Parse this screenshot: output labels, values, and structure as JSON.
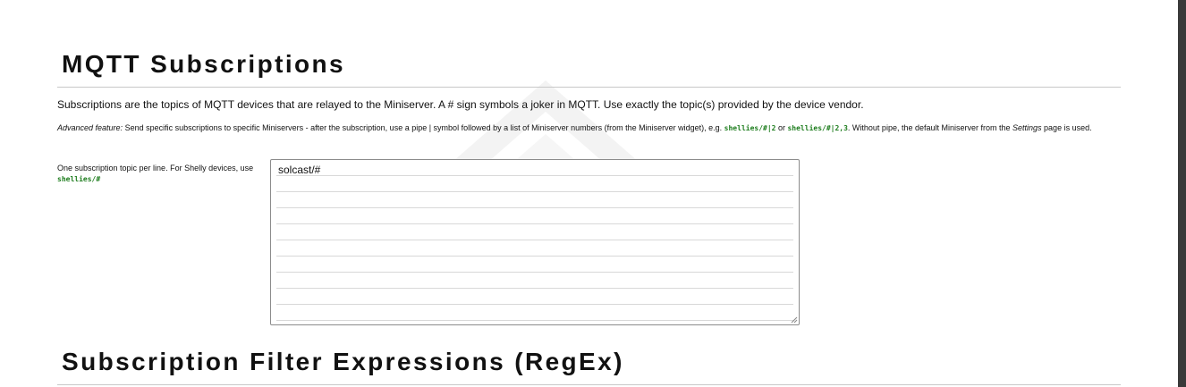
{
  "mqtt_section": {
    "title": "MQTT Subscriptions",
    "intro": "Subscriptions are the topics of MQTT devices that are relayed to the Miniserver. A # sign symbols a joker in MQTT. Use exactly the topic(s) provided by the device vendor.",
    "advanced": {
      "label": "Advanced feature:",
      "text_1": " Send specific subscriptions to specific Miniservers - after the subscription, use a pipe | symbol followed by a list of Miniserver numbers (from the Miniserver widget), e.g. ",
      "example_1": "shellies/#|2",
      "or": " or ",
      "example_2": "shellies/#|2,3",
      "text_2": ". Without pipe, the default Miniserver from the ",
      "settings": "Settings",
      "text_3": " page is used."
    },
    "help": {
      "text": "One subscription topic per line. For Shelly devices, use ",
      "code": "shellies/#"
    },
    "subscriptions": {
      "lines": [
        "solcast/#",
        "",
        "",
        "",
        "",
        "",
        "",
        "",
        "",
        ""
      ]
    }
  },
  "filter_section": {
    "title": "Subscription Filter Expressions (RegEx)"
  },
  "colors": {
    "code_green": "#1e7d1e",
    "rule": "#c8c8c8",
    "scrollbar_edge": "#3a3a3a"
  },
  "icons": {
    "resize_handle": "resize-grip-icon",
    "watermark": "roof-logo-watermark"
  }
}
